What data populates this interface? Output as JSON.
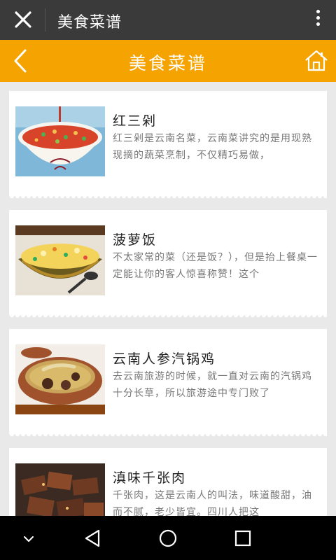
{
  "topbar": {
    "title": "美食菜谱"
  },
  "header": {
    "title": "美食菜谱",
    "accent": "#f4a300"
  },
  "recipes": [
    {
      "title": "红三剁",
      "desc": "红三剁是云南名菜，云南菜讲究的是用现熟现摘的蔬菜烹制，不仅精巧易做，"
    },
    {
      "title": "菠萝饭",
      "desc": "不太家常的菜（还是饭？），但是抬上餐桌一定能让你的客人惊喜称赞！这个"
    },
    {
      "title": "云南人参汽锅鸡",
      "desc": "去云南旅游的时候，就一直对云南的汽锅鸡十分长草，所以旅游途中专门败了"
    },
    {
      "title": "滇味千张肉",
      "desc": "千张肉，这是云南人的叫法，味道酸甜，油而不腻，老少皆宜。四川人把这"
    }
  ]
}
